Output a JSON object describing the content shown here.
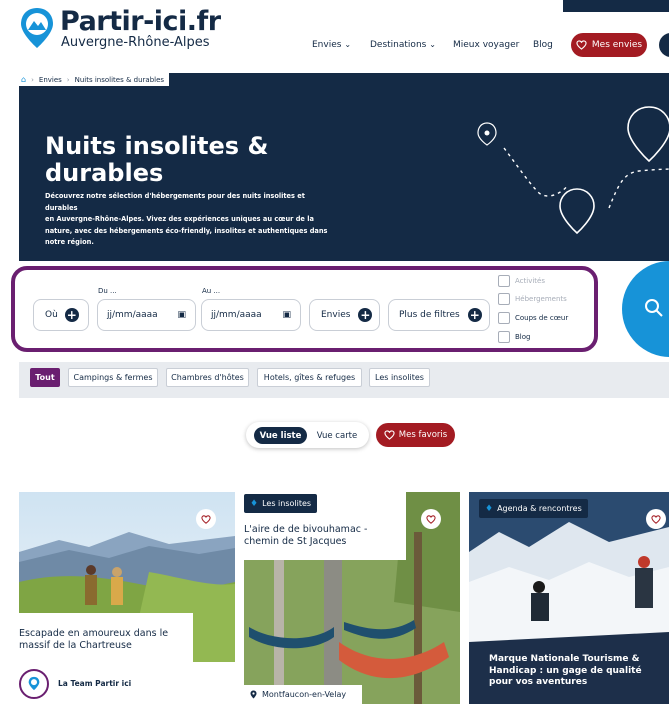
{
  "header": {
    "brand": "Partir-ici.fr",
    "region": "Auvergne-Rhône-Alpes",
    "nav": [
      "Envies",
      "Destinations",
      "Mieux voyager",
      "Blog"
    ],
    "mes_envies": "Mes envies"
  },
  "breadcrumb": [
    "Envies",
    "Nuits insolites & durables"
  ],
  "hero": {
    "title_line1": "Nuits insolites &",
    "title_line2": "durables",
    "text_lines": [
      "Découvrez notre sélection d'hébergements pour des nuits insolites et durables",
      "en Auvergne-Rhône-Alpes. Vivez des expériences uniques au cœur de la",
      "nature, avec des hébergements éco-friendly, insolites et authentiques dans",
      "notre région."
    ]
  },
  "filters": {
    "where_label": "Où",
    "from_label": "Du ...",
    "to_label": "Au ...",
    "date_placeholder": "jj/mm/aaaa",
    "envies_label": "Envies",
    "more_filters_label": "Plus de filtres",
    "checkboxes": [
      "Activités",
      "Hébergements",
      "Coups de cœur",
      "Blog"
    ]
  },
  "categories": [
    "Tout",
    "Campings & fermes",
    "Chambres d'hôtes",
    "Hotels, gîtes & refuges",
    "Les insolites"
  ],
  "view": {
    "list": "Vue liste",
    "map": "Vue carte",
    "favorites": "Mes favoris"
  },
  "cards": [
    {
      "tag": "",
      "title_lines": [
        "Escapade en amoureux dans le",
        "massif de la Chartreuse"
      ],
      "author": "La Team Partir ici",
      "location": ""
    },
    {
      "tag": "Les insolites",
      "title_lines": [
        "L'aire de de bivouhamac -",
        "chemin de St Jacques"
      ],
      "author": "",
      "location": "Montfaucon-en-Velay"
    },
    {
      "tag": "Agenda & rencontres",
      "title_lines": [
        "Marque Nationale Tourisme &",
        "Handicap : un gage de qualité",
        "pour vos aventures"
      ],
      "author": "",
      "location": ""
    }
  ],
  "colors": {
    "navy": "#142a45",
    "accent_red": "#a31b22",
    "purple": "#6a1f70",
    "search_blue": "#1793d8"
  },
  "icons": [
    "home-icon",
    "chevron-down-icon",
    "heart-icon",
    "plus-icon",
    "calendar-icon",
    "search-icon",
    "tag-icon",
    "location-pin-icon"
  ]
}
